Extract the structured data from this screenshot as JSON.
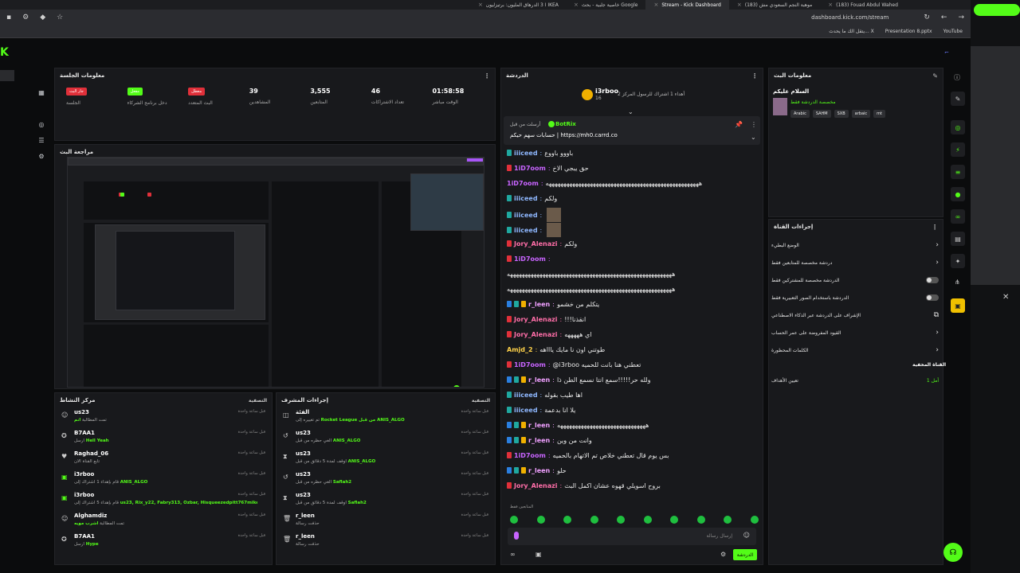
{
  "browser": {
    "tabs": [
      {
        "label": "ا 3 الدرهاق المليون: برتيزليون IKEA",
        "active": false
      },
      {
        "label": "خاصية جلبية - بحث Google",
        "active": false
      },
      {
        "label": "Stream - Kick Dashboard",
        "active": true
      },
      {
        "label": "(183) موهبة النجم السعودي مش",
        "active": false
      },
      {
        "label": "(183) Fouad Abdul Wahed",
        "active": false
      }
    ],
    "url": "dashboard.kick.com/stream",
    "bookmarks": [
      "يتقل الك ما يحدث... X",
      "Presentation 8.pptx",
      "YouTube"
    ]
  },
  "session": {
    "title": "معلومات الجلسة",
    "stats": [
      {
        "value": "",
        "label": "الجلسة",
        "badge": "جار البث",
        "badge_color": "#e0303a"
      },
      {
        "value": "",
        "label": "دخل برنامج الشركاء",
        "badge": "مفعل",
        "badge_color": "#53fc18"
      },
      {
        "value": "",
        "label": "البث المتعدد",
        "badge": "معطل",
        "badge_color": "#e0303a"
      },
      {
        "value": "39",
        "label": "المشاهدين",
        "badge": ""
      },
      {
        "value": "3,555",
        "label": "المتابعين",
        "badge": ""
      },
      {
        "value": "46",
        "label": "تعداد الاشتراكات",
        "badge": ""
      },
      {
        "value": "01:58:58",
        "label": "الوقت مباشر",
        "badge": ""
      }
    ]
  },
  "preview": {
    "title": "مراجعة البث"
  },
  "activity": {
    "title": "مركز النشاط",
    "filter": "التصفية",
    "items": [
      {
        "icon": "user-icon",
        "name": "us23",
        "desc": "تمت المطالبة",
        "highlight": "انم",
        "time": "قبل ساعة واحدة"
      },
      {
        "icon": "kick-icon",
        "name": "B7AA1",
        "desc": "أرسل",
        "highlight": "Hell Yeah",
        "time": "قبل ساعة واحدة"
      },
      {
        "icon": "heart-icon",
        "name": "Raghad_06",
        "desc": "تابع القناة الآن",
        "highlight": "",
        "time": "قبل ساعة واحدة"
      },
      {
        "icon": "gift-icon",
        "name": "i3rboo",
        "desc": "قام بإهداء 1 اشتراك إلى",
        "highlight": "ANIS_ALGO",
        "time": "قبل ساعة واحدة"
      },
      {
        "icon": "gift-icon",
        "name": "i3rboo",
        "desc": "قام بإهداء 5 اشتراك إلى",
        "highlight": "us23, Rix_y22, Fabry313, Ozbar, Hisqueezedpitt767mikenik",
        "time": "قبل ساعة واحدة"
      },
      {
        "icon": "user-icon",
        "name": "Alghamdiz",
        "desc": "تمت المطالبة",
        "highlight": "اشرب مويه",
        "time": "قبل ساعة واحدة"
      },
      {
        "icon": "kick-icon",
        "name": "B7AA1",
        "desc": "أرسل",
        "highlight": "Hype",
        "time": "قبل ساعة واحدة"
      }
    ]
  },
  "modactions": {
    "title": "إجراءات المشرف",
    "filter": "التصفية",
    "items": [
      {
        "icon": "category-icon",
        "name": "الفئة",
        "desc": "تم تغييره إلى",
        "highlight": "Rocket League من قبل ANIS_ALGO",
        "time": "قبل ساعة واحدة"
      },
      {
        "icon": "undo-icon",
        "name": "us23",
        "desc": "ألغي حظره من قبل",
        "highlight": "ANIS_ALGO",
        "time": "قبل ساعة واحدة"
      },
      {
        "icon": "hourglass-icon",
        "name": "us23",
        "desc": "أوقف لمدة 5 دقائق من قبل",
        "highlight": "ANIS_ALGO",
        "time": "قبل ساعة واحدة"
      },
      {
        "icon": "undo-icon",
        "name": "us23",
        "desc": "ألغي حظره من قبل",
        "highlight": "Saflah2",
        "time": "قبل ساعة واحدة"
      },
      {
        "icon": "hourglass-icon",
        "name": "us23",
        "desc": "أوقف لمدة 5 دقائق من قبل",
        "highlight": "Saflah2",
        "time": "قبل ساعة واحدة"
      },
      {
        "icon": "trash-icon",
        "name": "r_leen",
        "desc": "حذفت رسالة",
        "highlight": "",
        "time": "قبل ساعة واحدة"
      },
      {
        "icon": "trash-icon",
        "name": "r_leen",
        "desc": "حذفت رسالة",
        "highlight": "",
        "time": "قبل ساعة واحدة"
      }
    ]
  },
  "chat": {
    "title": "الدردشة",
    "gift_user": "i3rboo",
    "gift_count": "16",
    "gift_text": "أهداء 1 اشتراك للرسول المركز 2",
    "pinned_user": "BotRix",
    "pinned_by": "أرسلت من قبل",
    "pinned_text": "حسابات سهم حيكم | https://mh0.carrd.co",
    "messages": [
      {
        "user": "iiiceed",
        "color": "#8fb8ff",
        "text": "باووو باووع",
        "badges": [
          "#1fa8a0"
        ]
      },
      {
        "user": "1iD7oom",
        "color": "#c864ff",
        "text": "حق يبجي الاخ",
        "badges": [
          "#e0303a"
        ]
      },
      {
        "user": "1iD7oom",
        "color": "#c864ff",
        "text": "ههههههههههههههههههههههههههههههههههههههههههههههههههههه",
        "badges": []
      },
      {
        "user": "iiiceed",
        "color": "#8fb8ff",
        "text": "ولكم",
        "badges": [
          "#1fa8a0"
        ]
      },
      {
        "user": "iiiceed",
        "color": "#8fb8ff",
        "text": "",
        "badges": [
          "#1fa8a0"
        ],
        "emote": true
      },
      {
        "user": "iiiceed",
        "color": "#8fb8ff",
        "text": "",
        "badges": [
          "#1fa8a0"
        ],
        "emote": true
      },
      {
        "user": "Jory_Alenazi",
        "color": "#ff6ea8",
        "text": "ولكم",
        "badges": [
          "#e0303a"
        ]
      },
      {
        "user": "1iD7oom",
        "color": "#c864ff",
        "text": "",
        "badges": [
          "#e0303a"
        ]
      },
      {
        "user": "",
        "color": "#ffffff",
        "text": "ههههههههههههههههههههههههههههههههههههههههههههههههههههههههه",
        "badges": []
      },
      {
        "user": "",
        "color": "#ffffff",
        "text": "ههههههههههههههههههههههههههههههههههههههههههههههههههههههههه",
        "badges": []
      },
      {
        "user": "r_leen",
        "color": "#f0a0ff",
        "text": "يتكلم من خشمو",
        "badges": [
          "#2a7fe0",
          "#1fa8a0",
          "#f0b000"
        ]
      },
      {
        "user": "Jory_Alenazi",
        "color": "#ff6ea8",
        "text": "!!!انقذنا",
        "badges": [
          "#e0303a"
        ]
      },
      {
        "user": "Jory_Alenazi",
        "color": "#ff6ea8",
        "text": "اي هههههه",
        "badges": [
          "#e0303a"
        ]
      },
      {
        "user": "Amjd_2",
        "color": "#ffd24a",
        "text": "طوتني اون نا مايك ياااهه",
        "badges": []
      },
      {
        "user": "1iD7oom",
        "color": "#c864ff",
        "text": "@i3rboo تعطني هنا بانت للحميه",
        "badges": [
          "#e0303a"
        ]
      },
      {
        "user": "r_leen",
        "color": "#f0a0ff",
        "text": "ولله حر!!!!!سمع انتا نسمع الطن ذا",
        "badges": [
          "#2a7fe0",
          "#1fa8a0",
          "#f0b000"
        ]
      },
      {
        "user": "iiiceed",
        "color": "#8fb8ff",
        "text": "اها طيب بقوله",
        "badges": [
          "#1fa8a0"
        ]
      },
      {
        "user": "iiiceed",
        "color": "#8fb8ff",
        "text": "يلا انا بدعمة",
        "badges": [
          "#1fa8a0"
        ]
      },
      {
        "user": "r_leen",
        "color": "#f0a0ff",
        "text": "ههههههههههههههههههههههههههههههه",
        "badges": [
          "#2a7fe0",
          "#1fa8a0",
          "#f0b000"
        ]
      },
      {
        "user": "r_leen",
        "color": "#f0a0ff",
        "text": "وانت من وين",
        "badges": [
          "#2a7fe0",
          "#1fa8a0",
          "#f0b000"
        ]
      },
      {
        "user": "1iD7oom",
        "color": "#c864ff",
        "text": "بس يوم قال تعطني خلاص تم الاتهام بالحميه",
        "badges": [
          "#e0303a"
        ]
      },
      {
        "user": "r_leen",
        "color": "#f0a0ff",
        "text": "حلو",
        "badges": [
          "#2a7fe0",
          "#1fa8a0",
          "#f0b000"
        ]
      },
      {
        "user": "Jory_Alenazi",
        "color": "#ff6ea8",
        "text": "بروح اسويلي قهوه عشان اكمل البث",
        "badges": [
          "#e0303a"
        ]
      }
    ],
    "followers_only": "المتابعين فقط",
    "input_placeholder": "إرسال رسالة",
    "send_label": "الدردشة"
  },
  "streaminfo": {
    "title": "معلومات البث",
    "stream_title": "السلام عليكم",
    "category": "مخصصة الدردشة فقط",
    "tags": [
      "mt",
      "arbaic",
      "SXB",
      "SAHM",
      "Arabic"
    ]
  },
  "actions": {
    "title": "إجراءات القناة",
    "items": [
      {
        "label": "الوضع البطيء",
        "control": "chevron"
      },
      {
        "label": "دردشة مخصصة للمتابعين فقط",
        "control": "chevron"
      },
      {
        "label": "الدردشة مخصصة للمشتركين فقط",
        "control": "toggle"
      },
      {
        "label": "الدردشة باستخدام الصور التعبيرية فقط",
        "control": "toggle"
      },
      {
        "label": "الإشراف على الدردشة عبر الذكاء الاصطناعي",
        "control": "link"
      },
      {
        "label": "القيود المفروضة على عمر الحساب",
        "control": "chevron"
      },
      {
        "label": "الكلمات المحظورة",
        "control": "chevron"
      }
    ],
    "section": "القناة المخفية",
    "goal_label": "تعيين الأهداف",
    "goal_value": "أمل 1"
  }
}
